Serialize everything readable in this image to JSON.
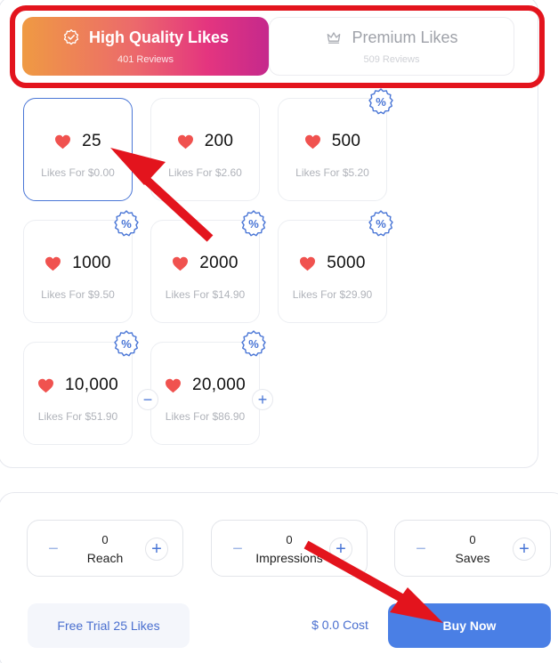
{
  "tabs": {
    "high_quality": {
      "title": "High Quality Likes",
      "reviews": "401 Reviews",
      "icon": "badge-check-icon"
    },
    "premium": {
      "title": "Premium Likes",
      "reviews": "509 Reviews",
      "icon": "crown-icon"
    }
  },
  "options": [
    {
      "qty": "25",
      "price": "Likes For $0.00",
      "selected": true,
      "badge": false
    },
    {
      "qty": "200",
      "price": "Likes For $2.60",
      "selected": false,
      "badge": false
    },
    {
      "qty": "500",
      "price": "Likes For $5.20",
      "selected": false,
      "badge": true
    },
    {
      "qty": "1000",
      "price": "Likes For $9.50",
      "selected": false,
      "badge": true
    },
    {
      "qty": "2000",
      "price": "Likes For $14.90",
      "selected": false,
      "badge": true
    },
    {
      "qty": "5000",
      "price": "Likes For $29.90",
      "selected": false,
      "badge": true
    },
    {
      "qty": "10,000",
      "price": "Likes For $51.90",
      "selected": false,
      "badge": true
    },
    {
      "qty": "20,000",
      "price": "Likes For $86.90",
      "selected": false,
      "badge": true
    }
  ],
  "badge_symbol": "%",
  "stepper": {
    "minus": "−",
    "plus": "+"
  },
  "counters": [
    {
      "value": "0",
      "label": "Reach"
    },
    {
      "value": "0",
      "label": "Impressions"
    },
    {
      "value": "0",
      "label": "Saves"
    }
  ],
  "footer": {
    "trial_label": "Free Trial 25 Likes",
    "cost": "$ 0.0 Cost",
    "buy_label": "Buy Now"
  },
  "colors": {
    "accent": "#4a7fe5",
    "heart": "#f0524f",
    "annotation_red": "#e3141d"
  }
}
